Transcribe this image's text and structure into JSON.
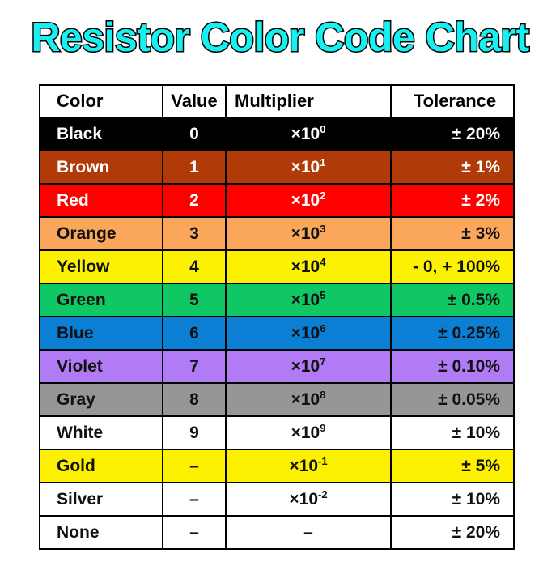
{
  "title": "Resistor Color Code Chart",
  "theme": {
    "title_fill": "#16f0f0",
    "title_stroke": "#000000",
    "page_background": "#ffffff",
    "grid_line": "#000000"
  },
  "table": {
    "headers": {
      "color": "Color",
      "value": "Value",
      "multiplier": "Multiplier",
      "tolerance": "Tolerance"
    },
    "rows": [
      {
        "color": "Black",
        "value": "0",
        "multiplier_base": "×10",
        "multiplier_exp": "0",
        "tolerance": "± 20%",
        "bg": "#000000",
        "fg": "#ffffff"
      },
      {
        "color": "Brown",
        "value": "1",
        "multiplier_base": "×10",
        "multiplier_exp": "1",
        "tolerance": "± 1%",
        "bg": "#b13b08",
        "fg": "#ffffff"
      },
      {
        "color": "Red",
        "value": "2",
        "multiplier_base": "×10",
        "multiplier_exp": "2",
        "tolerance": "± 2%",
        "bg": "#fe0000",
        "fg": "#ffffff"
      },
      {
        "color": "Orange",
        "value": "3",
        "multiplier_base": "×10",
        "multiplier_exp": "3",
        "tolerance": "± 3%",
        "bg": "#faa75b",
        "fg": "#111111"
      },
      {
        "color": "Yellow",
        "value": "4",
        "multiplier_base": "×10",
        "multiplier_exp": "4",
        "tolerance": "- 0, + 100%",
        "bg": "#fcf100",
        "fg": "#111111"
      },
      {
        "color": "Green",
        "value": "5",
        "multiplier_base": "×10",
        "multiplier_exp": "5",
        "tolerance": "± 0.5%",
        "bg": "#10c765",
        "fg": "#111111"
      },
      {
        "color": "Blue",
        "value": "6",
        "multiplier_base": "×10",
        "multiplier_exp": "6",
        "tolerance": "± 0.25%",
        "bg": "#0b7fd4",
        "fg": "#111111"
      },
      {
        "color": "Violet",
        "value": "7",
        "multiplier_base": "×10",
        "multiplier_exp": "7",
        "tolerance": "± 0.10%",
        "bg": "#b17bf5",
        "fg": "#111111"
      },
      {
        "color": "Gray",
        "value": "8",
        "multiplier_base": "×10",
        "multiplier_exp": "8",
        "tolerance": "± 0.05%",
        "bg": "#969696",
        "fg": "#111111"
      },
      {
        "color": "White",
        "value": "9",
        "multiplier_base": "×10",
        "multiplier_exp": "9",
        "tolerance": "± 10%",
        "bg": "#ffffff",
        "fg": "#111111"
      },
      {
        "color": "Gold",
        "value": "–",
        "multiplier_base": "×10",
        "multiplier_exp": "-1",
        "tolerance": "± 5%",
        "bg": "#fcf100",
        "fg": "#111111"
      },
      {
        "color": "Silver",
        "value": "–",
        "multiplier_base": "×10",
        "multiplier_exp": "-2",
        "tolerance": "± 10%",
        "bg": "#ffffff",
        "fg": "#111111"
      },
      {
        "color": "None",
        "value": "–",
        "multiplier_base": "–",
        "multiplier_exp": "",
        "tolerance": "± 20%",
        "bg": "#ffffff",
        "fg": "#111111"
      }
    ]
  }
}
